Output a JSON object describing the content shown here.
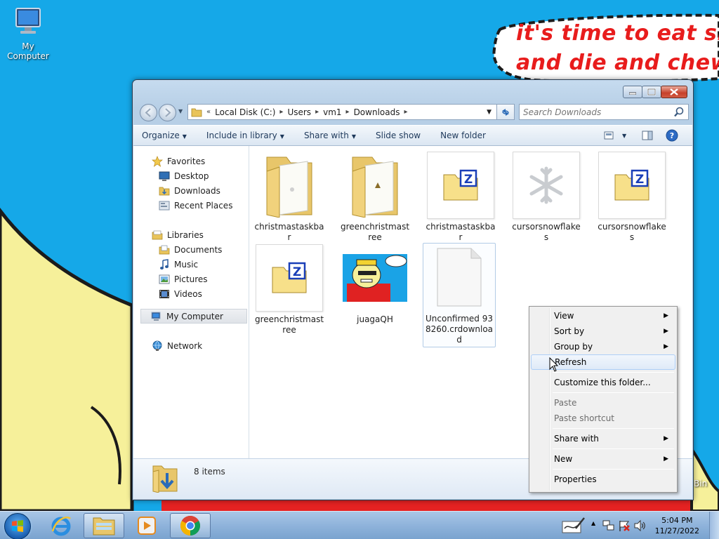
{
  "desktop": {
    "icons": [
      {
        "label": "My Computer"
      }
    ],
    "wallpaper_text": [
      "it's time to eat shit",
      "and die and chew"
    ],
    "partial_labels": {
      "recycle_bin_fragment": "Bin"
    }
  },
  "explorer": {
    "breadcrumb": {
      "overflow": "«",
      "segments": [
        "Local Disk (C:)",
        "Users",
        "vm1",
        "Downloads"
      ]
    },
    "search": {
      "placeholder": "Search Downloads"
    },
    "toolbar": {
      "organize": "Organize",
      "include_in_library": "Include in library",
      "share_with": "Share with",
      "slide_show": "Slide show",
      "new_folder": "New folder"
    },
    "nav_pane": {
      "favorites": "Favorites",
      "favorites_items": [
        "Desktop",
        "Downloads",
        "Recent Places"
      ],
      "libraries": "Libraries",
      "libraries_items": [
        "Documents",
        "Music",
        "Pictures",
        "Videos"
      ],
      "my_computer": "My Computer",
      "network": "Network"
    },
    "files": [
      {
        "name": "christmastaskbar",
        "type": "folder"
      },
      {
        "name": "greenchristmastree",
        "type": "folder"
      },
      {
        "name": "christmastaskbar",
        "type": "archive"
      },
      {
        "name": "cursorsnowflakes",
        "type": "snowflake"
      },
      {
        "name": "cursorsnowflakes",
        "type": "archive"
      },
      {
        "name": "greenchristmastree",
        "type": "archive"
      },
      {
        "name": "juagaQH",
        "type": "image"
      },
      {
        "name": "Unconfirmed 938260.crdownload",
        "type": "document"
      }
    ],
    "status": {
      "item_count": "8 items"
    }
  },
  "context_menu": {
    "view": "View",
    "sort_by": "Sort by",
    "group_by": "Group by",
    "refresh": "Refresh",
    "customize": "Customize this folder...",
    "paste": "Paste",
    "paste_shortcut": "Paste shortcut",
    "share_with": "Share with",
    "new": "New",
    "properties": "Properties"
  },
  "taskbar": {
    "pinned": [
      "Internet Explorer",
      "Windows Explorer",
      "Windows Media Player",
      "Google Chrome"
    ],
    "clock": {
      "time": "5:04 PM",
      "date": "11/27/2022"
    }
  },
  "colors": {
    "desktop_background": "#15a8e8",
    "wallpaper_red": "#e81c1c",
    "wallpaper_yellow": "#f6f09a",
    "taskbar": "#8fb3db"
  }
}
